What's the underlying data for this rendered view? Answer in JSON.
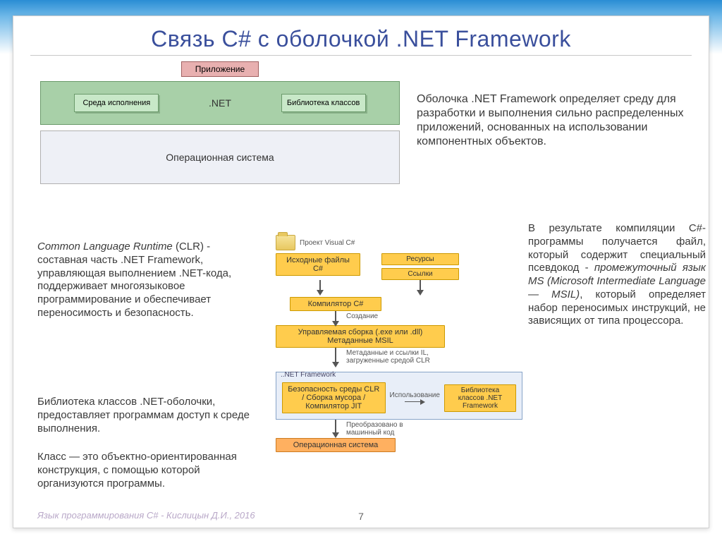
{
  "title": "Связь C# с оболочкой .NET Framework",
  "top_diagram": {
    "app": "Приложение",
    "runtime": "Среда исполнения",
    "net": ".NET",
    "classlib": "Библиотека классов",
    "os": "Операционная система"
  },
  "texts": {
    "clr": "Common Language Runtime (CLR) - составная часть .NET Framework, управляющая выполнением .NET-кода, поддерживает многоязыковое программирование и обеспечивает переносимость и безопасность.",
    "lib": "Библиотека классов .NET-оболочки, предоставляет программам доступ к среде выполнения.",
    "class": "Класс — это объектно-ориентированная конструкция, с помощью которой организуются программы.",
    "oblochka": "Оболочка .NET Framework определяет среду для разработки и выполнения сильно распределенных приложений, основанных на использовании компонентных объектов.",
    "result": "В результате компиляции C#-программы получается файл, который содержит специальный псевдокод - промежуточный язык MS (Microsoft Intermediate Language — MSIL), который определяет набор переносимых инструкций, не зависящих от типа процессора."
  },
  "flow": {
    "project": "Проект Visual C#",
    "src": "Исходные файлы C#",
    "resources": "Ресурсы",
    "links": "Ссылки",
    "compiler": "Компилятор C#",
    "create": "Создание",
    "assembly": "Управляемая сборка (.exe или .dll)\nМетаданные MSIL",
    "meta": "Метаданные и ссылки IL, загруженные средой CLR",
    "net_caption": "..NET Framework",
    "clr_box": "Безопасность среды CLR / Сборка мусора / Компилятор JIT",
    "use": "Использование",
    "classlib": "Библиотека классов .NET Framework",
    "native": "Преобразовано в машинный код",
    "os": "Операционная система"
  },
  "footer": "Язык программирования C# - Кислицын Д.И., 2016",
  "page": "7"
}
